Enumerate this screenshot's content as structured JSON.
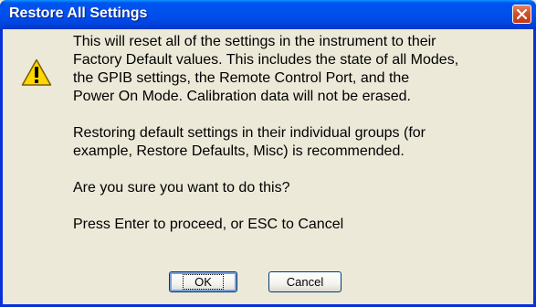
{
  "dialog": {
    "title": "Restore All Settings",
    "close_icon": "close-icon",
    "warning_icon": "warning-icon",
    "message_lines": [
      "This will reset all of the settings in the instrument to their",
      "Factory Default values.   This includes the state of all Modes,",
      "the GPIB settings, the Remote Control Port, and the",
      "Power On Mode.  Calibration data will not be erased.",
      "Restoring default settings in their individual groups (for",
      "example, Restore Defaults, Misc) is recommended.",
      "Are you sure you want to do this?",
      "Press Enter to proceed, or ESC to Cancel"
    ],
    "buttons": {
      "ok_label": "OK",
      "cancel_label": "Cancel"
    },
    "colors": {
      "titlebar": "#0053ee",
      "window_border": "#0831d9",
      "body": "#ece9d8",
      "close_button": "#d0502b",
      "warning_yellow": "#ffd700"
    }
  }
}
